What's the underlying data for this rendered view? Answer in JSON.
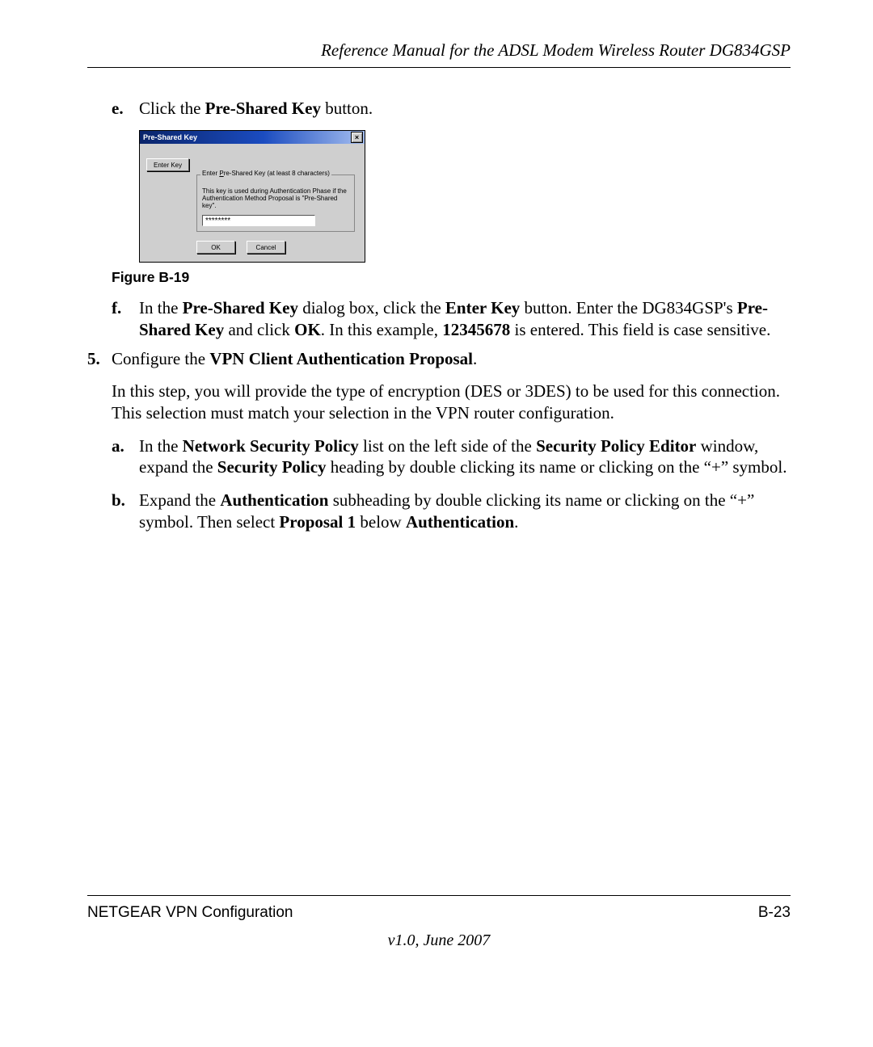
{
  "header": {
    "title": "Reference Manual for the ADSL Modem Wireless Router DG834GSP"
  },
  "step_e": {
    "marker": "e.",
    "prefix": "Click the ",
    "bold": "Pre-Shared Key",
    "suffix": " button."
  },
  "dialog": {
    "title": "Pre-Shared Key",
    "close_glyph": "×",
    "enter_key_label": "Enter Key",
    "group_legend_pre": "Enter ",
    "group_legend_underline": "P",
    "group_legend_post": "re-Shared Key (at least 8 characters)",
    "help_line1": "This key is used during Authentication Phase if the",
    "help_line2": "Authentication Method Proposal is \"Pre-Shared key\".",
    "password_mask": "********",
    "ok_label": "OK",
    "cancel_label": "Cancel"
  },
  "figure_caption": "Figure B-19",
  "step_f": {
    "marker": "f.",
    "text_parts": [
      {
        "t": "In the "
      },
      {
        "t": "Pre-Shared Key",
        "b": true
      },
      {
        "t": " dialog box, click the "
      },
      {
        "t": "Enter Key",
        "b": true
      },
      {
        "t": " button. Enter the DG834GSP's "
      },
      {
        "t": "Pre-Shared Key",
        "b": true
      },
      {
        "t": " and click "
      },
      {
        "t": "OK",
        "b": true
      },
      {
        "t": ". In this example, "
      },
      {
        "t": "12345678",
        "b": true
      },
      {
        "t": " is entered. This field is case sensitive."
      }
    ]
  },
  "step_5": {
    "marker": "5.",
    "line_parts": [
      {
        "t": "Configure the "
      },
      {
        "t": "VPN Client Authentication Proposal",
        "b": true
      },
      {
        "t": "."
      }
    ],
    "para": "In this step, you will provide the type of encryption (DES or 3DES) to be used for this connection. This selection must match your selection in the VPN router configuration."
  },
  "step_5a": {
    "marker": "a.",
    "parts": [
      {
        "t": "In the "
      },
      {
        "t": "Network Security Policy",
        "b": true
      },
      {
        "t": " list on the left side of the "
      },
      {
        "t": "Security Policy Editor",
        "b": true
      },
      {
        "t": " window, expand the "
      },
      {
        "t": "Security Policy",
        "b": true
      },
      {
        "t": " heading by double clicking its name or clicking on the “+” symbol."
      }
    ]
  },
  "step_5b": {
    "marker": "b.",
    "parts": [
      {
        "t": "Expand the "
      },
      {
        "t": "Authentication",
        "b": true
      },
      {
        "t": " subheading by double clicking its name or clicking on the “+” symbol. Then select "
      },
      {
        "t": "Proposal 1",
        "b": true
      },
      {
        "t": " below "
      },
      {
        "t": "Authentication",
        "b": true
      },
      {
        "t": "."
      }
    ]
  },
  "footer": {
    "left": "NETGEAR VPN Configuration",
    "right": "B-23",
    "version": "v1.0, June 2007"
  }
}
